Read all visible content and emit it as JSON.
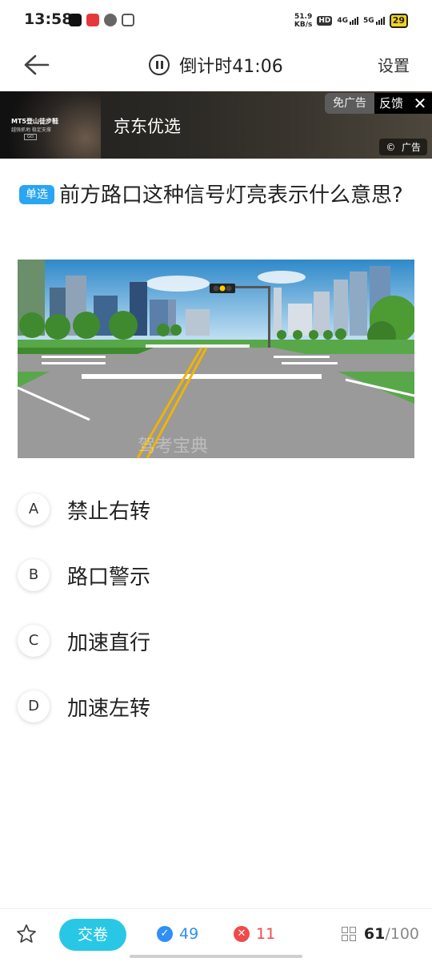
{
  "status_bar": {
    "time": "13:58",
    "net_speed": "51.9",
    "net_unit": "KB/s",
    "hd_label": "HD",
    "signal_1": "4G",
    "signal_2": "5G",
    "battery": "29"
  },
  "header": {
    "timer_label": "倒计时41:06",
    "settings_label": "设置"
  },
  "ad": {
    "thumb_title": "MT5登山徒步鞋",
    "thumb_subtitle": "越强抓地 稳定支撑",
    "thumb_button": "GO",
    "name": "京东优选",
    "no_ad_label": "免广告",
    "feedback_label": "反馈",
    "tag_label": "广告"
  },
  "question": {
    "type_badge": "单选",
    "text": "前方路口这种信号灯亮表示什么意思?",
    "image_watermark": "驾考宝典"
  },
  "options": [
    {
      "letter": "A",
      "text": "禁止右转"
    },
    {
      "letter": "B",
      "text": "路口警示"
    },
    {
      "letter": "C",
      "text": "加速直行"
    },
    {
      "letter": "D",
      "text": "加速左转"
    }
  ],
  "bottom_bar": {
    "submit_label": "交卷",
    "correct_count": "49",
    "wrong_count": "11",
    "current": "61",
    "total": "/100"
  },
  "colors": {
    "accent": "#29c7e6",
    "badge_blue": "#2aa5f2",
    "correct_blue": "#2f8ff5",
    "wrong_red": "#f04a4a"
  }
}
